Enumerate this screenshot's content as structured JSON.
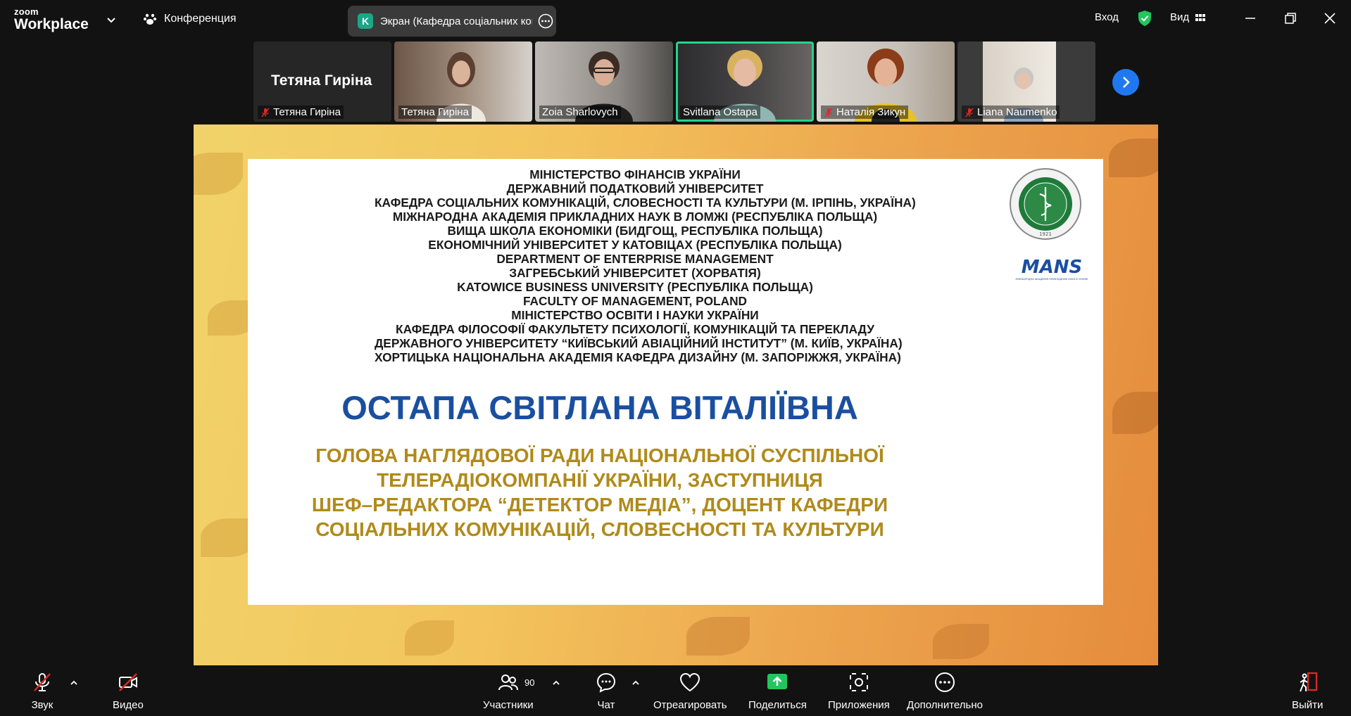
{
  "app": {
    "logo_top": "zoom",
    "logo_bottom": "Workplace"
  },
  "header": {
    "meeting_label": "Конференция",
    "share_initial": "K",
    "share_title": "Экран (Кафедра соціальних комунікацій",
    "login": "Вход",
    "view": "Вид"
  },
  "participants": [
    {
      "name": "Тетяна Гиріна",
      "big_name": "Тетяна Гиріна",
      "muted": true,
      "video": false
    },
    {
      "name": "Тетяна Гиріна",
      "muted": false,
      "video": true
    },
    {
      "name": "Zoia Sharlovych",
      "muted": false,
      "video": true
    },
    {
      "name": "Svitlana Ostapa",
      "muted": false,
      "video": true,
      "active_speaker": true
    },
    {
      "name": "Наталія Зикун",
      "muted": true,
      "video": true
    },
    {
      "name": "Liana Naumenko",
      "muted": true,
      "video": true
    }
  ],
  "slide": {
    "institutions": [
      "МІНІСТЕРСТВО ФІНАНСІВ УКРАЇНИ",
      "ДЕРЖАВНИЙ ПОДАТКОВИЙ УНІВЕРСИТЕТ",
      "КАФЕДРА СОЦІАЛЬНИХ КОМУНІКАЦІЙ, СЛОВЕСНОСТІ ТА КУЛЬТУРИ (М. ІРПІНЬ, УКРАЇНА)",
      "МІЖНАРОДНА АКАДЕМІЯ ПРИКЛАДНИХ НАУК В ЛОМЖІ (РЕСПУБЛІКА ПОЛЬЩА)",
      "ВИЩА ШКОЛА ЕКОНОМІКИ (БИДГОЩ, РЕСПУБЛІКА ПОЛЬЩА)",
      "ЕКОНОМІЧНИЙ УНІВЕРСИТЕТ У КАТОВІЦАХ  (РЕСПУБЛІКА ПОЛЬЩА)",
      "DEPARTMENT OF ENTERPRISE MANAGEMENT",
      "ЗАГРЕБСЬКИЙ УНІВЕРСИТЕТ (ХОРВАТІЯ)",
      "KATOWICE BUSINESS UNIVERSITY (РЕСПУБЛІКА ПОЛЬЩА)",
      "FACULTY OF MANAGEMENT, POLAND",
      "МІНІСТЕРСТВО ОСВІТИ І НАУКИ УКРАЇНИ",
      "КАФЕДРА ФІЛОСОФІЇ ФАКУЛЬТЕТУ ПСИХОЛОГІЇ, КОМУНІКАЦІЙ ТА ПЕРЕКЛАДУ",
      "ДЕРЖАВНОГО УНІВЕРСИТЕТУ “КИЇВСЬКИЙ АВІАЦІЙНИЙ ІНСТИТУТ” (М. КИЇВ, УКРАЇНА)",
      "ХОРТИЦЬКА НАЦІОНАЛЬНА АКАДЕМІЯ КАФЕДРА ДИЗАЙНУ (М. ЗАПОРІЖЖЯ, УКРАЇНА)"
    ],
    "person_name": "ОСТАПА СВІТЛАНА ВІТАЛІЇВНА",
    "role_lines": [
      "ГОЛОВА НАГЛЯДОВОЇ РАДИ НАЦІОНАЛЬНОЇ СУСПІЛЬНОЇ",
      "ТЕЛЕРАДІОКОМПАНІЇ УКРАЇНИ, ЗАСТУПНИЦЯ",
      "ШЕФ–РЕДАКТОРА “ДЕТЕКТОР МЕДІА”, ДОЦЕНТ КАФЕДРИ",
      "СОЦІАЛЬНИХ КОМУНІКАЦІЙ, СЛОВЕСНОСТІ ТА КУЛЬТУРИ"
    ],
    "logo_mans": "MANS",
    "logo_mans_caption": "МІЖНАРОДНА АКАДЕМІЯ ПРИКЛАДНИХ НАУК В ЛОМЖІ",
    "seal_text": "ДЕРЖАВНИЙ ПОДАТКОВИЙ УНІВЕРСИТЕТ",
    "seal_year": "1921"
  },
  "toolbar": {
    "audio": "Звук",
    "video": "Видео",
    "participants": "Участники",
    "participants_count": "90",
    "chat": "Чат",
    "react": "Отреагировать",
    "share": "Поделиться",
    "apps": "Приложения",
    "more": "Дополнительно",
    "leave": "Выйти"
  },
  "colors": {
    "accent_green": "#21d58c",
    "share_green": "#22c55e",
    "leave_red": "#e02828",
    "next_blue": "#1f78f0",
    "title_blue": "#1a4fa0",
    "role_gold": "#b08a1a"
  }
}
